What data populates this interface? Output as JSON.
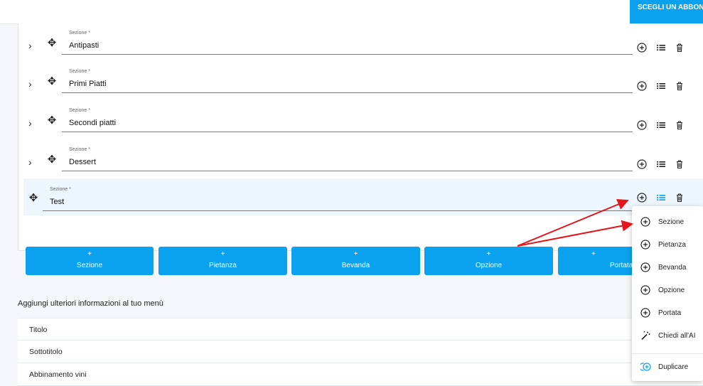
{
  "header": {
    "cta_label": "SCEGLI UN ABBONA"
  },
  "sections": [
    {
      "label": "Sezione *",
      "value": "Antipasti"
    },
    {
      "label": "Sezione *",
      "value": "Primi Piatti"
    },
    {
      "label": "Sezione *",
      "value": "Secondi piatti"
    },
    {
      "label": "Sezione *",
      "value": "Dessert"
    },
    {
      "label": "Sezione *",
      "value": "Test"
    }
  ],
  "add_buttons": {
    "plus": "+",
    "sezione": "Sezione",
    "pietanza": "Pietanza",
    "bevanda": "Bevanda",
    "opzione": "Opzione",
    "portata": "Portata"
  },
  "extra": {
    "title": "Aggiungi ulteriori informazioni al tuo menù",
    "items": [
      "Titolo",
      "Sottotitolo",
      "Abbinamento vini"
    ]
  },
  "context_menu": {
    "items": [
      "Sezione",
      "Pietanza",
      "Bevanda",
      "Opzione",
      "Portata",
      "Chiedi all'AI"
    ],
    "duplicate": "Duplicare"
  },
  "colors": {
    "accent": "#0aa1ee",
    "annotation": "#e8141b"
  }
}
